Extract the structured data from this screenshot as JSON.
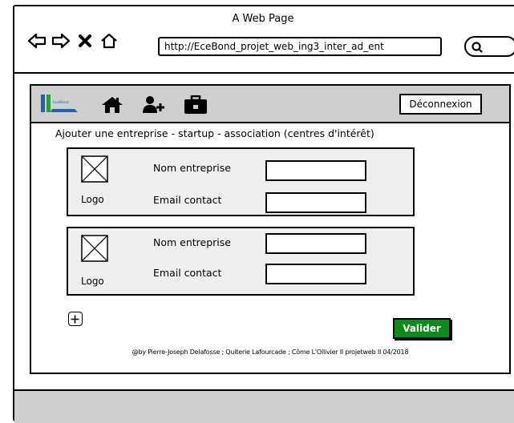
{
  "browser": {
    "window_title": "A Web Page",
    "address": "http://EceBond_projet_web_ing3_inter_ad_ent",
    "nav_icons": [
      "back-arrow-icon",
      "forward-arrow-icon",
      "close-x-icon",
      "home-outline-icon"
    ],
    "search_icon": "search-icon"
  },
  "header": {
    "logo_text": "EceBond",
    "icons": [
      "home-icon",
      "add-user-icon",
      "briefcase-icon"
    ],
    "logout_label": "Déconnexion"
  },
  "main": {
    "section_title": "Ajouter une entreprise - startup - association (centres d'intérêt)",
    "entries": [
      {
        "logo_caption": "Logo",
        "name_label": "Nom entreprise",
        "name_value": "",
        "email_label": "Email contact",
        "email_value": ""
      },
      {
        "logo_caption": "Logo",
        "name_label": "Nom entreprise",
        "name_value": "",
        "email_label": "Email contact",
        "email_value": ""
      }
    ],
    "add_icon": "plus-square-icon",
    "validate_label": "Valider"
  },
  "footer": {
    "credit": "@by Pierre-Joseph Delafosse ; Quiterie Lafourcade ; Côme L'Ollivier II projetweb II 04/2018"
  },
  "colors": {
    "header_bg": "#cfcfcf",
    "card_bg": "#efefef",
    "validate_bg": "#0d8a1c",
    "logo_blue": "#1e64b4",
    "logo_green": "#2e9a3e"
  }
}
